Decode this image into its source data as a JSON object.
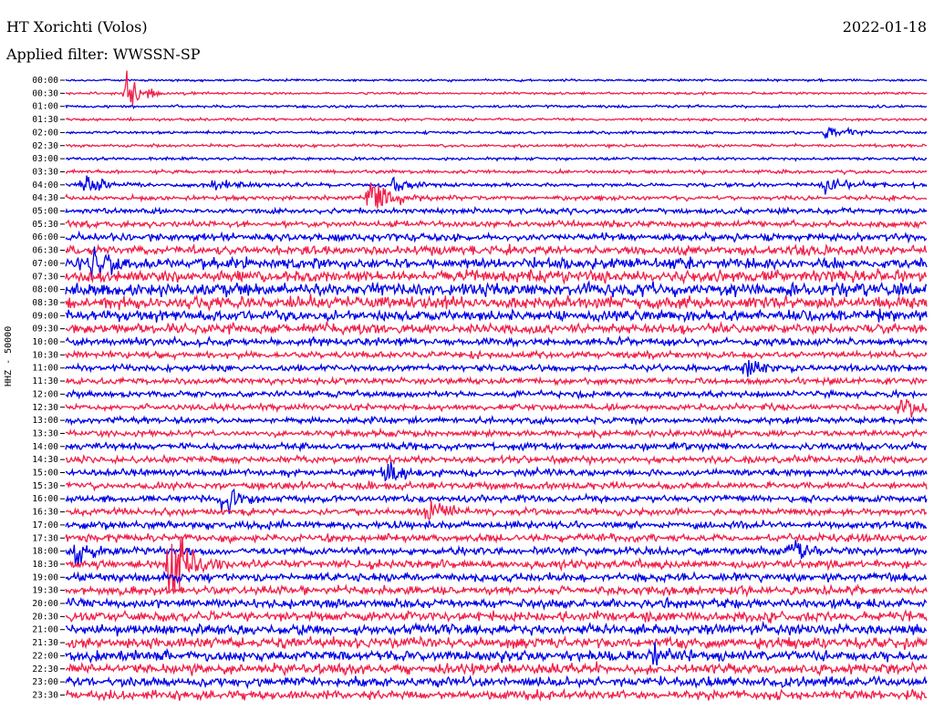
{
  "header": {
    "station_title": "HT Xorichti (Volos)",
    "date": "2022-01-18",
    "filter_label": "Applied filter: WWSSN-SP"
  },
  "colors": {
    "blue": "#0000e6",
    "red": "#f0204a"
  },
  "chart_data": {
    "type": "helicorder",
    "ylabel": "HHZ - 50000",
    "time_labels": [
      "00:00",
      "00:30",
      "01:00",
      "01:30",
      "02:00",
      "02:30",
      "03:00",
      "03:30",
      "04:00",
      "04:30",
      "05:00",
      "05:30",
      "06:00",
      "06:30",
      "07:00",
      "07:30",
      "08:00",
      "08:30",
      "09:00",
      "09:30",
      "10:00",
      "10:30",
      "11:00",
      "11:30",
      "12:00",
      "12:30",
      "13:00",
      "13:30",
      "14:00",
      "14:30",
      "15:00",
      "15:30",
      "16:00",
      "16:30",
      "17:00",
      "17:30",
      "18:00",
      "18:30",
      "19:00",
      "19:30",
      "20:00",
      "20:30",
      "21:00",
      "21:30",
      "22:00",
      "22:30",
      "23:00",
      "23:30"
    ],
    "noise_level": [
      0.8,
      0.8,
      0.9,
      0.9,
      1.0,
      1.0,
      1.0,
      1.2,
      1.4,
      1.6,
      1.8,
      2.2,
      2.6,
      3.2,
      3.8,
      4.2,
      4.4,
      4.2,
      3.8,
      3.4,
      2.6,
      2.4,
      2.2,
      2.2,
      2.2,
      2.2,
      2.2,
      2.2,
      2.4,
      2.4,
      2.4,
      2.4,
      2.4,
      2.4,
      2.6,
      2.6,
      2.6,
      2.8,
      2.8,
      3.0,
      3.2,
      3.4,
      3.6,
      3.8,
      3.6,
      3.6,
      3.4,
      3.2
    ],
    "events": [
      {
        "row": 1,
        "t": 0.07,
        "amp": 16
      },
      {
        "row": 4,
        "t": 0.88,
        "amp": 8
      },
      {
        "row": 8,
        "t": 0.02,
        "amp": 10
      },
      {
        "row": 8,
        "t": 0.17,
        "amp": 6
      },
      {
        "row": 8,
        "t": 0.38,
        "amp": 8
      },
      {
        "row": 8,
        "t": 0.88,
        "amp": 8
      },
      {
        "row": 9,
        "t": 0.35,
        "amp": 22
      },
      {
        "row": 14,
        "t": 0.03,
        "amp": 14
      },
      {
        "row": 22,
        "t": 0.79,
        "amp": 8
      },
      {
        "row": 25,
        "t": 0.97,
        "amp": 10
      },
      {
        "row": 30,
        "t": 0.37,
        "amp": 7
      },
      {
        "row": 32,
        "t": 0.18,
        "amp": 12
      },
      {
        "row": 33,
        "t": 0.42,
        "amp": 9
      },
      {
        "row": 36,
        "t": 0.01,
        "amp": 12
      },
      {
        "row": 36,
        "t": 0.84,
        "amp": 6
      },
      {
        "row": 37,
        "t": 0.12,
        "amp": 40
      },
      {
        "row": 44,
        "t": 0.68,
        "amp": 12
      }
    ]
  }
}
